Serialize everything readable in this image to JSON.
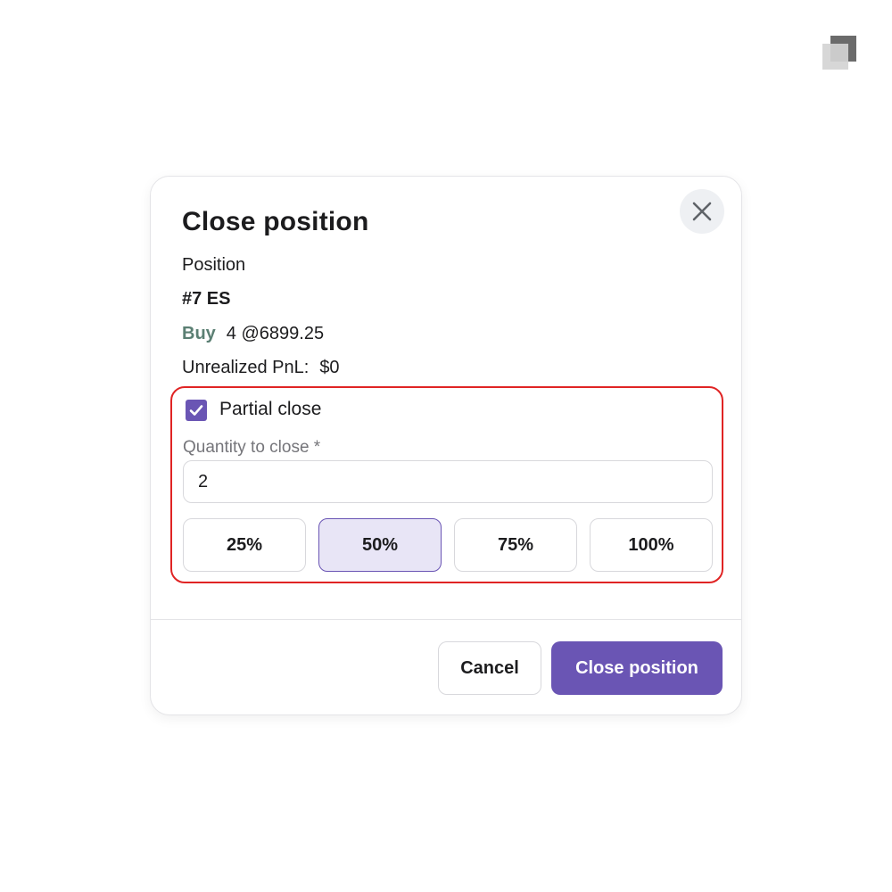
{
  "app": {
    "logo_icon": "layered-squares-logo"
  },
  "dialog": {
    "title": "Close position",
    "close_icon": "close-icon",
    "position_label": "Position",
    "position_id": "#7 ES",
    "side": "Buy",
    "side_color": "#5b7f73",
    "order_summary": "4 @6899.25",
    "pnl_label": "Unrealized PnL:",
    "pnl_value": "$0",
    "partial_close": {
      "checked": true,
      "label": "Partial close",
      "checkbox_icon": "check-icon"
    },
    "quantity": {
      "label": "Quantity to close *",
      "value": "2"
    },
    "percent_buttons": [
      {
        "label": "25%",
        "selected": false
      },
      {
        "label": "50%",
        "selected": true
      },
      {
        "label": "75%",
        "selected": false
      },
      {
        "label": "100%",
        "selected": false
      }
    ],
    "cancel_label": "Cancel",
    "confirm_label": "Close position"
  },
  "colors": {
    "accent": "#6a55b4",
    "accent_light": "#e8e5f6",
    "highlight_border": "#e02424"
  }
}
